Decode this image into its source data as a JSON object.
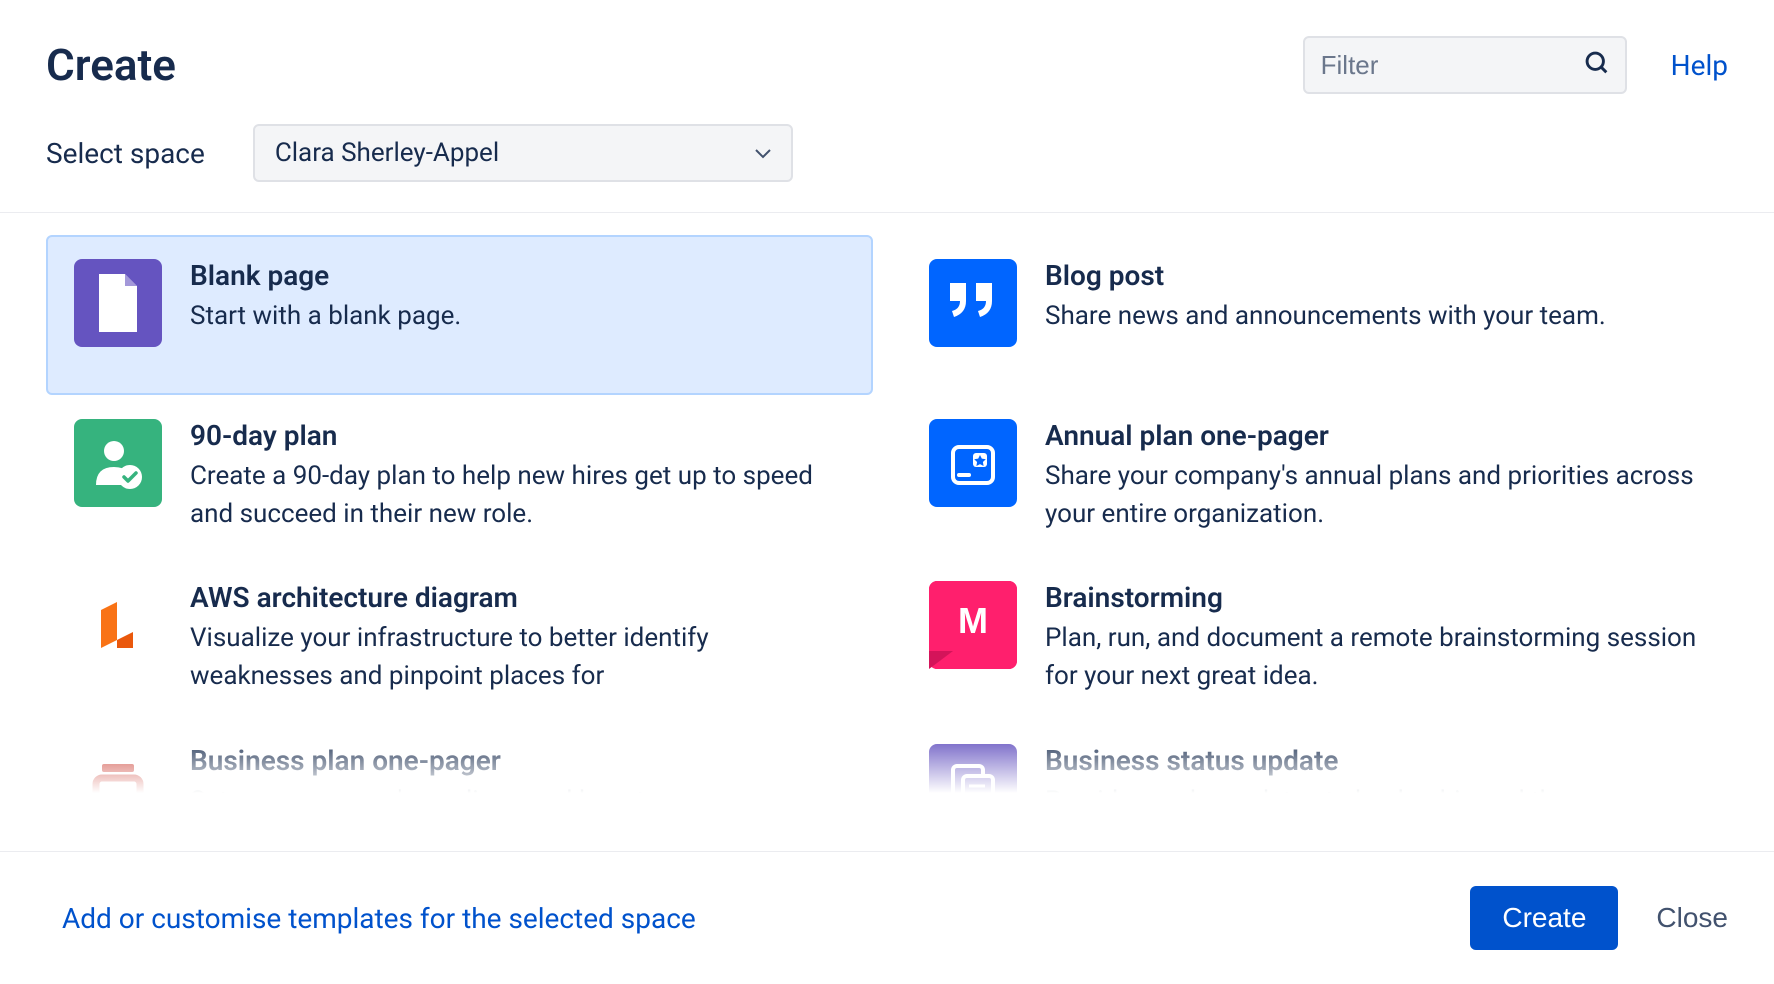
{
  "header": {
    "title": "Create",
    "filter_placeholder": "Filter",
    "help_label": "Help"
  },
  "space": {
    "label": "Select space",
    "selected": "Clara Sherley-Appel"
  },
  "templates": [
    {
      "id": "blank-page",
      "title": "Blank page",
      "desc": "Start with a blank page.",
      "icon": "page",
      "color": "#6554C0",
      "selected": true
    },
    {
      "id": "blog-post",
      "title": "Blog post",
      "desc": "Share news and announcements with your team.",
      "icon": "quote",
      "color": "#0065FF",
      "selected": false
    },
    {
      "id": "90-day-plan",
      "title": "90-day plan",
      "desc": "Create a 90-day plan to help new hires get up to speed and succeed in their new role.",
      "icon": "user-check",
      "color": "#36B37E",
      "selected": false
    },
    {
      "id": "annual-plan",
      "title": "Annual plan one-pager",
      "desc": "Share your company's annual plans and priorities across your entire organization.",
      "icon": "star-doc",
      "color": "#0065FF",
      "selected": false
    },
    {
      "id": "aws-arch",
      "title": "AWS architecture diagram",
      "desc": "Visualize your infrastructure to better identify weaknesses and pinpoint places for",
      "icon": "lucid",
      "color": "transparent",
      "selected": false
    },
    {
      "id": "brainstorm",
      "title": "Brainstorming",
      "desc": "Plan, run, and document a remote brainstorming session for your next great idea.",
      "icon": "mural",
      "color": "#FF1F6D",
      "selected": false
    },
    {
      "id": "biz-plan",
      "title": "Business plan one-pager",
      "desc": "Set your company's medium- and long-term",
      "icon": "box",
      "color": "transparent",
      "selected": false
    },
    {
      "id": "biz-status",
      "title": "Business status update",
      "desc": "Provide regular updates to leadership and the",
      "icon": "doc-list",
      "color": "#6554C0",
      "selected": false
    }
  ],
  "footer": {
    "customise_label": "Add or customise templates for the selected space",
    "create_label": "Create",
    "close_label": "Close"
  }
}
